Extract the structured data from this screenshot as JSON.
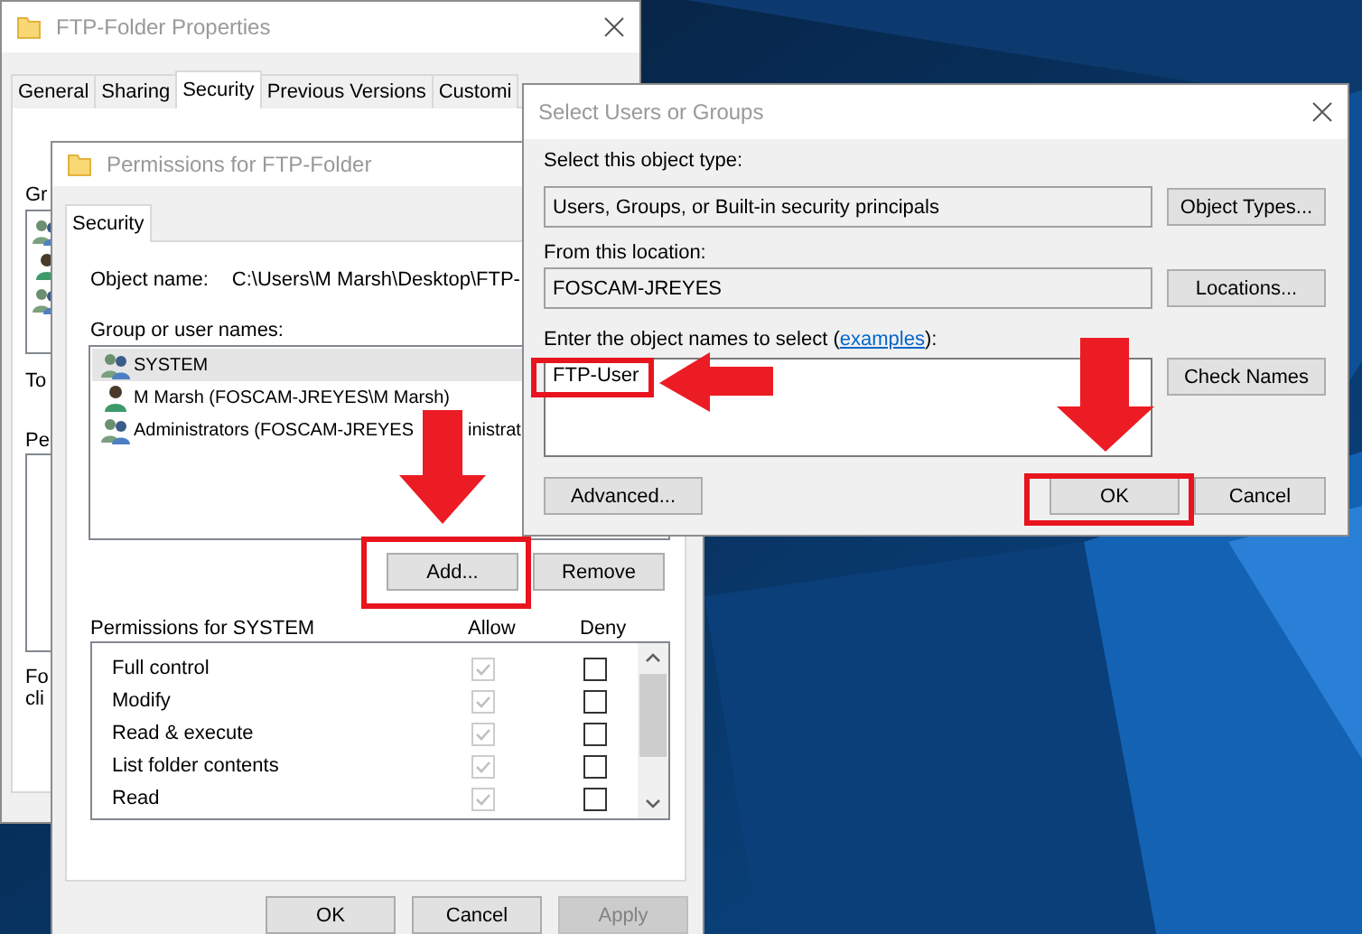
{
  "properties_window": {
    "title": "FTP-Folder Properties",
    "tabs": [
      {
        "label": "General",
        "selected": false
      },
      {
        "label": "Sharing",
        "selected": false
      },
      {
        "label": "Security",
        "selected": true
      },
      {
        "label": "Previous Versions",
        "selected": false
      },
      {
        "label": "Customi",
        "selected": false
      }
    ],
    "visible_fragments": [
      "Gr",
      "To",
      "Pe",
      "Fo",
      "cli"
    ]
  },
  "permissions_window": {
    "title": "Permissions for FTP-Folder",
    "tabs": [
      {
        "label": "Security",
        "selected": true
      }
    ],
    "object_name_label": "Object name:",
    "object_name": "C:\\Users\\M Marsh\\Desktop\\FTP-",
    "group_label": "Group or user names:",
    "principals": [
      {
        "name": "SYSTEM",
        "kind": "group",
        "selected": true
      },
      {
        "name": "M Marsh (FOSCAM-JREYES\\M Marsh)",
        "kind": "user",
        "selected": false
      },
      {
        "name": "Administrators (FOSCAM-JREYES",
        "name_after_arrow": "inistrat",
        "kind": "group",
        "selected": false
      }
    ],
    "add_button": "Add...",
    "remove_button": "Remove",
    "permissions_label": "Permissions for SYSTEM",
    "allow_header": "Allow",
    "deny_header": "Deny",
    "permissions": [
      {
        "name": "Full control",
        "allow": true,
        "inherited": true,
        "deny": false
      },
      {
        "name": "Modify",
        "allow": true,
        "inherited": true,
        "deny": false
      },
      {
        "name": "Read & execute",
        "allow": true,
        "inherited": true,
        "deny": false
      },
      {
        "name": "List folder contents",
        "allow": true,
        "inherited": true,
        "deny": false
      },
      {
        "name": "Read",
        "allow": true,
        "inherited": true,
        "deny": false
      }
    ],
    "buttons": [
      {
        "label": "OK",
        "disabled": false
      },
      {
        "label": "Cancel",
        "disabled": false
      },
      {
        "label": "Apply",
        "disabled": true
      }
    ]
  },
  "select_window": {
    "title": "Select Users or Groups",
    "object_type_label": "Select this object type:",
    "object_type": "Users, Groups, or Built-in security principals",
    "object_types_button": "Object Types...",
    "location_label": "From this location:",
    "location": "FOSCAM-JREYES",
    "locations_button": "Locations...",
    "names_label_start": "Enter the object names to select (",
    "names_link": "examples",
    "names_label_end": "):",
    "names_value": "FTP-User",
    "check_names_button": "Check Names",
    "advanced_button": "Advanced...",
    "ok_button": "OK",
    "cancel_button": "Cancel"
  }
}
